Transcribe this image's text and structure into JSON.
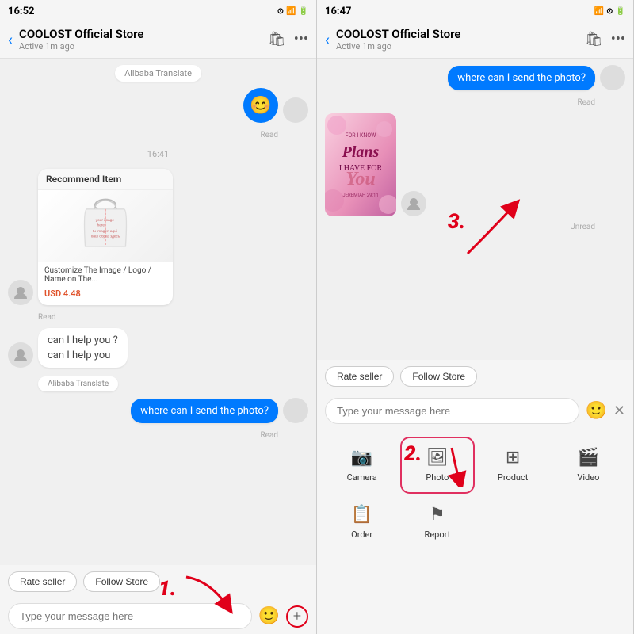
{
  "left_panel": {
    "status": {
      "time": "16:52",
      "icons": "⊙ 4G"
    },
    "header": {
      "back": "‹",
      "title": "COOLOST Official Store",
      "subtitle": "Active 1m ago",
      "icon1": "🛍",
      "icon2": "•••"
    },
    "messages": [
      {
        "type": "translate-pill",
        "text": "Alibaba Translate"
      },
      {
        "type": "emoji-out",
        "emoji": "😊",
        "status": "Read"
      },
      {
        "type": "time-divider",
        "text": "16:41"
      },
      {
        "type": "recommend-card",
        "header": "Recommend Item",
        "desc": "Customize The Image / Logo / Name on The...",
        "price": "USD 4.48",
        "status": "Read"
      },
      {
        "type": "multi-in",
        "lines": [
          "can I help you ?",
          "can I help you"
        ],
        "translate": "Alibaba Translate"
      },
      {
        "type": "msg-out-blue",
        "text": "where can I send the photo?",
        "status": "Read"
      }
    ],
    "quick_actions": [
      "Rate seller",
      "Follow Store"
    ],
    "input_placeholder": "Type your message here",
    "emoji_icon": "🙂",
    "plus_icon": "+",
    "annotation_1": "1."
  },
  "right_panel": {
    "status": {
      "time": "16:47",
      "icons": "4G ⊙"
    },
    "header": {
      "back": "‹",
      "title": "COOLOST Official Store",
      "subtitle": "Active 1m ago",
      "icon1": "🛍",
      "icon2": "•••"
    },
    "messages": [
      {
        "type": "msg-out-blue",
        "text": "where can I send the photo?",
        "status": "Read"
      },
      {
        "type": "img-in",
        "status": "Unread"
      }
    ],
    "quick_actions": [
      "Rate seller",
      "Follow Store"
    ],
    "input_placeholder": "Type your message here",
    "emoji_icon": "🙂",
    "close_icon": "✕",
    "grid_items": [
      {
        "icon": "📷",
        "label": "Camera"
      },
      {
        "icon": "🖼",
        "label": "Photo",
        "highlighted": true
      },
      {
        "icon": "⊞",
        "label": "Product"
      },
      {
        "icon": "🎬",
        "label": "Video"
      },
      {
        "icon": "📋",
        "label": "Order"
      },
      {
        "icon": "⚑",
        "label": "Report"
      }
    ],
    "annotation_2": "2.",
    "annotation_3": "3."
  }
}
